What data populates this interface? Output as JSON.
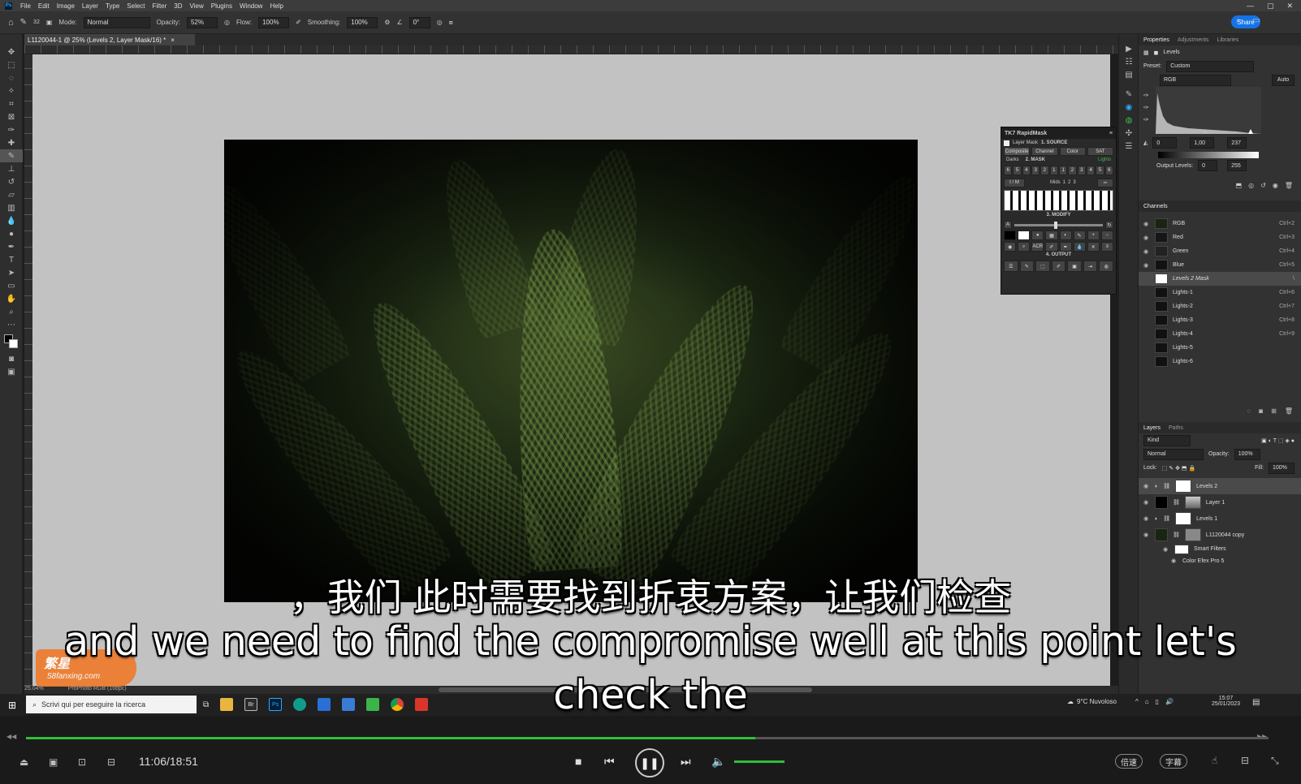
{
  "app": {
    "menu": [
      "File",
      "Edit",
      "Image",
      "Layer",
      "Type",
      "Select",
      "Filter",
      "3D",
      "View",
      "Plugins",
      "Window",
      "Help"
    ],
    "window_controls": [
      "—",
      "▢",
      "✕"
    ]
  },
  "options": {
    "brush_size": "32",
    "mode_label": "Mode:",
    "mode_value": "Normal",
    "opacity_label": "Opacity:",
    "opacity_value": "52%",
    "flow_label": "Flow:",
    "flow_value": "100%",
    "smoothing_label": "Smoothing:",
    "smoothing_value": "100%",
    "angle_value": "0°",
    "share_label": "Share"
  },
  "document": {
    "tab_title": "L1120044-1 @ 25% (Levels 2, Layer Mask/16) *",
    "zoom": "25.04%",
    "profile": "ProPhoto RGB (16bpc)"
  },
  "properties": {
    "tabs": [
      "Properties",
      "Adjustments",
      "Libraries"
    ],
    "adjustment": "Levels",
    "preset_label": "Preset:",
    "preset_value": "Custom",
    "channel": "RGB",
    "auto": "Auto",
    "input_black": "0",
    "input_gamma": "1,00",
    "input_white": "237",
    "output_label": "Output Levels:",
    "output_black": "0",
    "output_white": "255"
  },
  "channels": {
    "title": "Channels",
    "items": [
      {
        "name": "RGB",
        "shortcut": "Ctrl+2"
      },
      {
        "name": "Red",
        "shortcut": "Ctrl+3"
      },
      {
        "name": "Green",
        "shortcut": "Ctrl+4"
      },
      {
        "name": "Blue",
        "shortcut": "Ctrl+5"
      },
      {
        "name": "Levels 2 Mask",
        "shortcut": "\\"
      },
      {
        "name": "Lights-1",
        "shortcut": "Ctrl+6"
      },
      {
        "name": "Lights-2",
        "shortcut": "Ctrl+7"
      },
      {
        "name": "Lights-3",
        "shortcut": "Ctrl+8"
      },
      {
        "name": "Lights-4",
        "shortcut": "Ctrl+9"
      },
      {
        "name": "Lights-5",
        "shortcut": ""
      },
      {
        "name": "Lights-6",
        "shortcut": ""
      }
    ]
  },
  "layers": {
    "tabs": [
      "Layers",
      "Paths"
    ],
    "kind": "Kind",
    "blend": "Normal",
    "opacity_label": "Opacity:",
    "opacity": "100%",
    "lock_label": "Lock:",
    "fill_label": "Fill:",
    "fill": "100%",
    "items": [
      {
        "name": "Levels 2"
      },
      {
        "name": "Layer 1"
      },
      {
        "name": "Levels 1"
      },
      {
        "name": "L1120044 copy"
      },
      {
        "name": "Smart Filters"
      },
      {
        "name": "Color Efex Pro 5"
      }
    ]
  },
  "rapidmask": {
    "title": "TK7 RapidMask",
    "source": "1. SOURCE",
    "layer_mask": "Layer Mask",
    "source_tabs": [
      "Composite",
      "Channel",
      "Color",
      "SAT"
    ],
    "mask": "2. MASK",
    "darks": "Darks",
    "lights": "Lights",
    "num_row": [
      "6",
      "5",
      "4",
      "3",
      "2",
      "1",
      "1",
      "2",
      "3",
      "4",
      "5",
      "6"
    ],
    "im": "I / M",
    "mids": "Mids",
    "mids_nums": [
      "1",
      "2",
      "3"
    ],
    "modify": "3. MODIFY",
    "output": "4. OUTPUT",
    "acr": "ACR"
  },
  "taskbar": {
    "search_placeholder": "Scrivi qui per eseguire la ricerca",
    "weather": "9°C Nuvoloso",
    "time": "15:07",
    "date": "25/01/2023"
  },
  "player": {
    "time": "11:06/18:51",
    "progress": 0.587,
    "speed_label": "倍速",
    "subtitle_label": "字幕"
  },
  "subtitles": {
    "zh": "，我们 此时需要找到折衷方案，让我们检查",
    "en_line1": "and we need to find the compromise well at this point let's",
    "en_line2": "check the"
  },
  "watermark": {
    "brand": "繁星",
    "url": "58fanxing.com"
  }
}
